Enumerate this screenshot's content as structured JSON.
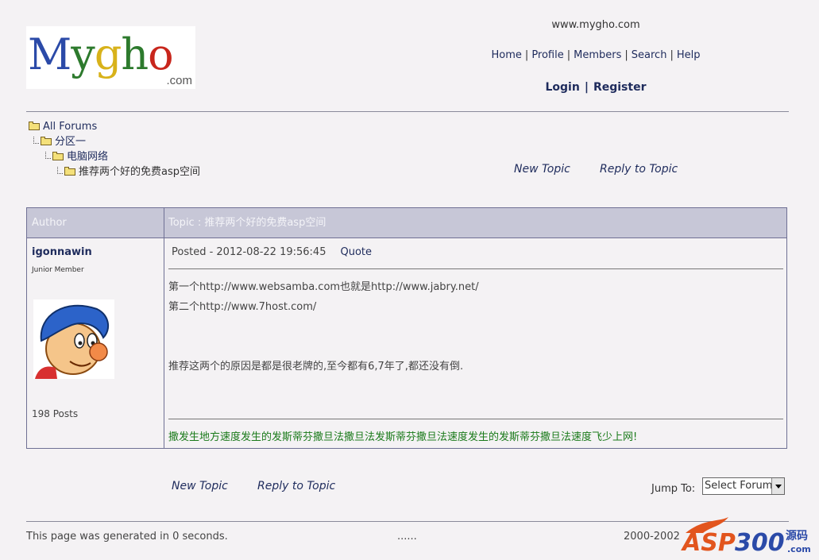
{
  "header": {
    "logo_text": "Mygho",
    "logo_suffix": ".com",
    "site_url": "www.mygho.com",
    "nav": [
      "Home",
      "Profile",
      "Members",
      "Search",
      "Help"
    ],
    "auth": [
      "Login",
      "Register"
    ]
  },
  "breadcrumb": [
    "All Forums",
    "分区一",
    "电脑网络",
    "推荐两个好的免费asp空间"
  ],
  "actions": {
    "new_topic": "New Topic",
    "reply": "Reply to Topic"
  },
  "table": {
    "head_author": "Author",
    "head_topic": "Topic : 推荐两个好的免费asp空间"
  },
  "post": {
    "author": "igonnawin",
    "rank": "Junior Member",
    "posts": "198 Posts",
    "posted": "Posted - 2012-08-22  19:56:45",
    "quote": "Quote",
    "lines": [
      "第一个http://www.websamba.com也就是http://www.jabry.net/",
      "第二个http://www.7host.com/",
      "推荐这两个的原因是都是很老牌的,至今都有6,7年了,都还没有倒."
    ],
    "signature": "撒发生地方速度发生的发斯蒂芬撒旦法撒旦法发斯蒂芬撒旦法速度发生的发斯蒂芬撒旦法速度飞少上网!"
  },
  "jump": {
    "label": "Jump To:",
    "selected": "Select Forum"
  },
  "footer": {
    "generated": "This page was generated in 0 seconds.",
    "dots": "......",
    "copyright": "2000-2002"
  },
  "watermark": {
    "text": "ASP300",
    "suffix": "源码",
    "domain": ".com"
  },
  "colors": {
    "link": "#1e2b5c",
    "table_head": "#c7c7d7",
    "signature": "#1a7a1a",
    "border": "#6f7094"
  }
}
